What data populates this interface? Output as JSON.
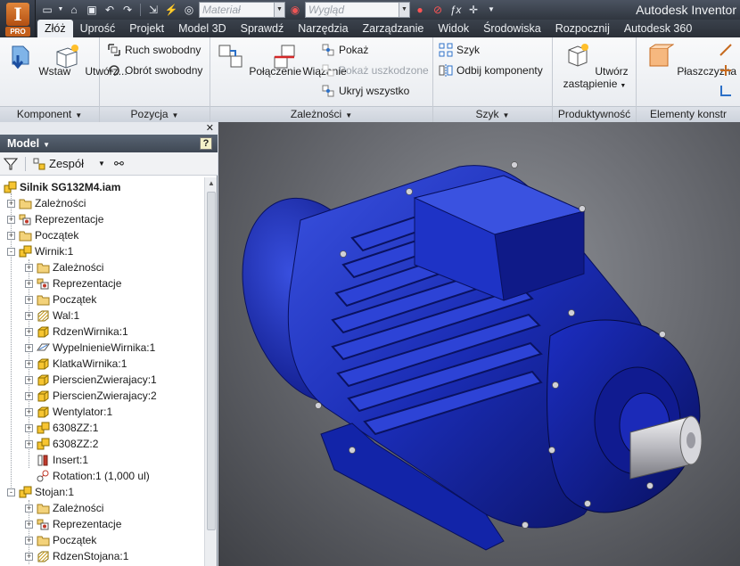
{
  "app": {
    "title": "Autodesk Inventor",
    "logo_letter": "I",
    "badge": "PRO"
  },
  "qat": {
    "material_placeholder": "Materiał",
    "appearance_placeholder": "Wygląd"
  },
  "tabs": [
    "Złóż",
    "Uprość",
    "Projekt",
    "Model 3D",
    "Sprawdź",
    "Narzędzia",
    "Zarządzanie",
    "Widok",
    "Środowiska",
    "Rozpocznij",
    "Autodesk 360"
  ],
  "ribbon": {
    "komponent": {
      "title": "Komponent",
      "wstaw": "Wstaw",
      "utworz": "Utwórz..."
    },
    "pozycja": {
      "title": "Pozycja",
      "ruch": "Ruch swobodny",
      "obrot": "Obrót swobodny"
    },
    "zaleznosci": {
      "title": "Zależności",
      "polaczenie": "Połączenie",
      "wiazanie": "Wiązanie",
      "pokaz": "Pokaż",
      "pokaz_uszk": "Pokaż uszkodzone",
      "ukryj": "Ukryj wszystko"
    },
    "szyk": {
      "title": "Szyk",
      "szyk": "Szyk",
      "odbij": "Odbij komponenty"
    },
    "produktywnosc": {
      "title": "Produktywność",
      "utworz_line1": "Utwórz",
      "utworz_line2": "zastąpienie"
    },
    "elementy": {
      "title": "Elementy konstr",
      "plaszczyzna": "Płaszczyzna"
    }
  },
  "browser": {
    "title": "Model",
    "help": "?",
    "filter_label": "Zespół",
    "root": "Silnik SG132M4.iam",
    "items": [
      {
        "label": "Zależności",
        "icon": "folder",
        "level": 1,
        "exp": "+"
      },
      {
        "label": "Reprezentacje",
        "icon": "rep",
        "level": 1,
        "exp": "+"
      },
      {
        "label": "Początek",
        "icon": "folder",
        "level": 1,
        "exp": "+"
      },
      {
        "label": "Wirnik:1",
        "icon": "asm",
        "level": 1,
        "exp": "-"
      },
      {
        "label": "Zależności",
        "icon": "folder",
        "level": 2,
        "exp": "+"
      },
      {
        "label": "Reprezentacje",
        "icon": "rep",
        "level": 2,
        "exp": "+"
      },
      {
        "label": "Początek",
        "icon": "folder",
        "level": 2,
        "exp": "+"
      },
      {
        "label": "Wal:1",
        "icon": "hatch",
        "level": 2,
        "exp": "+"
      },
      {
        "label": "RdzenWirnika:1",
        "icon": "part",
        "level": 2,
        "exp": "+"
      },
      {
        "label": "WypelnienieWirnika:1",
        "icon": "surf",
        "level": 2,
        "exp": "+"
      },
      {
        "label": "KlatkaWirnika:1",
        "icon": "part",
        "level": 2,
        "exp": "+"
      },
      {
        "label": "PierscienZwierajacy:1",
        "icon": "part",
        "level": 2,
        "exp": "+"
      },
      {
        "label": "PierscienZwierajacy:2",
        "icon": "part",
        "level": 2,
        "exp": "+"
      },
      {
        "label": "Wentylator:1",
        "icon": "part",
        "level": 2,
        "exp": "+"
      },
      {
        "label": "6308ZZ:1",
        "icon": "asm",
        "level": 2,
        "exp": "+"
      },
      {
        "label": "6308ZZ:2",
        "icon": "asm",
        "level": 2,
        "exp": "+"
      },
      {
        "label": "Insert:1",
        "icon": "insert",
        "level": 2,
        "exp": ""
      },
      {
        "label": "Rotation:1 (1,000 ul)",
        "icon": "rotation",
        "level": 2,
        "exp": ""
      },
      {
        "label": "Stojan:1",
        "icon": "asm",
        "level": 1,
        "exp": "-"
      },
      {
        "label": "Zależności",
        "icon": "folder",
        "level": 2,
        "exp": "+"
      },
      {
        "label": "Reprezentacje",
        "icon": "rep",
        "level": 2,
        "exp": "+"
      },
      {
        "label": "Początek",
        "icon": "folder",
        "level": 2,
        "exp": "+"
      },
      {
        "label": "RdzenStojana:1",
        "icon": "hatch",
        "level": 2,
        "exp": "+"
      }
    ]
  },
  "colors": {
    "motor": "#1a2cb4",
    "motor_dark": "#0c1466",
    "motor_light": "#3d55e6",
    "shaft": "#c8c8cc",
    "folder": "#f3d27a",
    "part": "#f7c531"
  }
}
